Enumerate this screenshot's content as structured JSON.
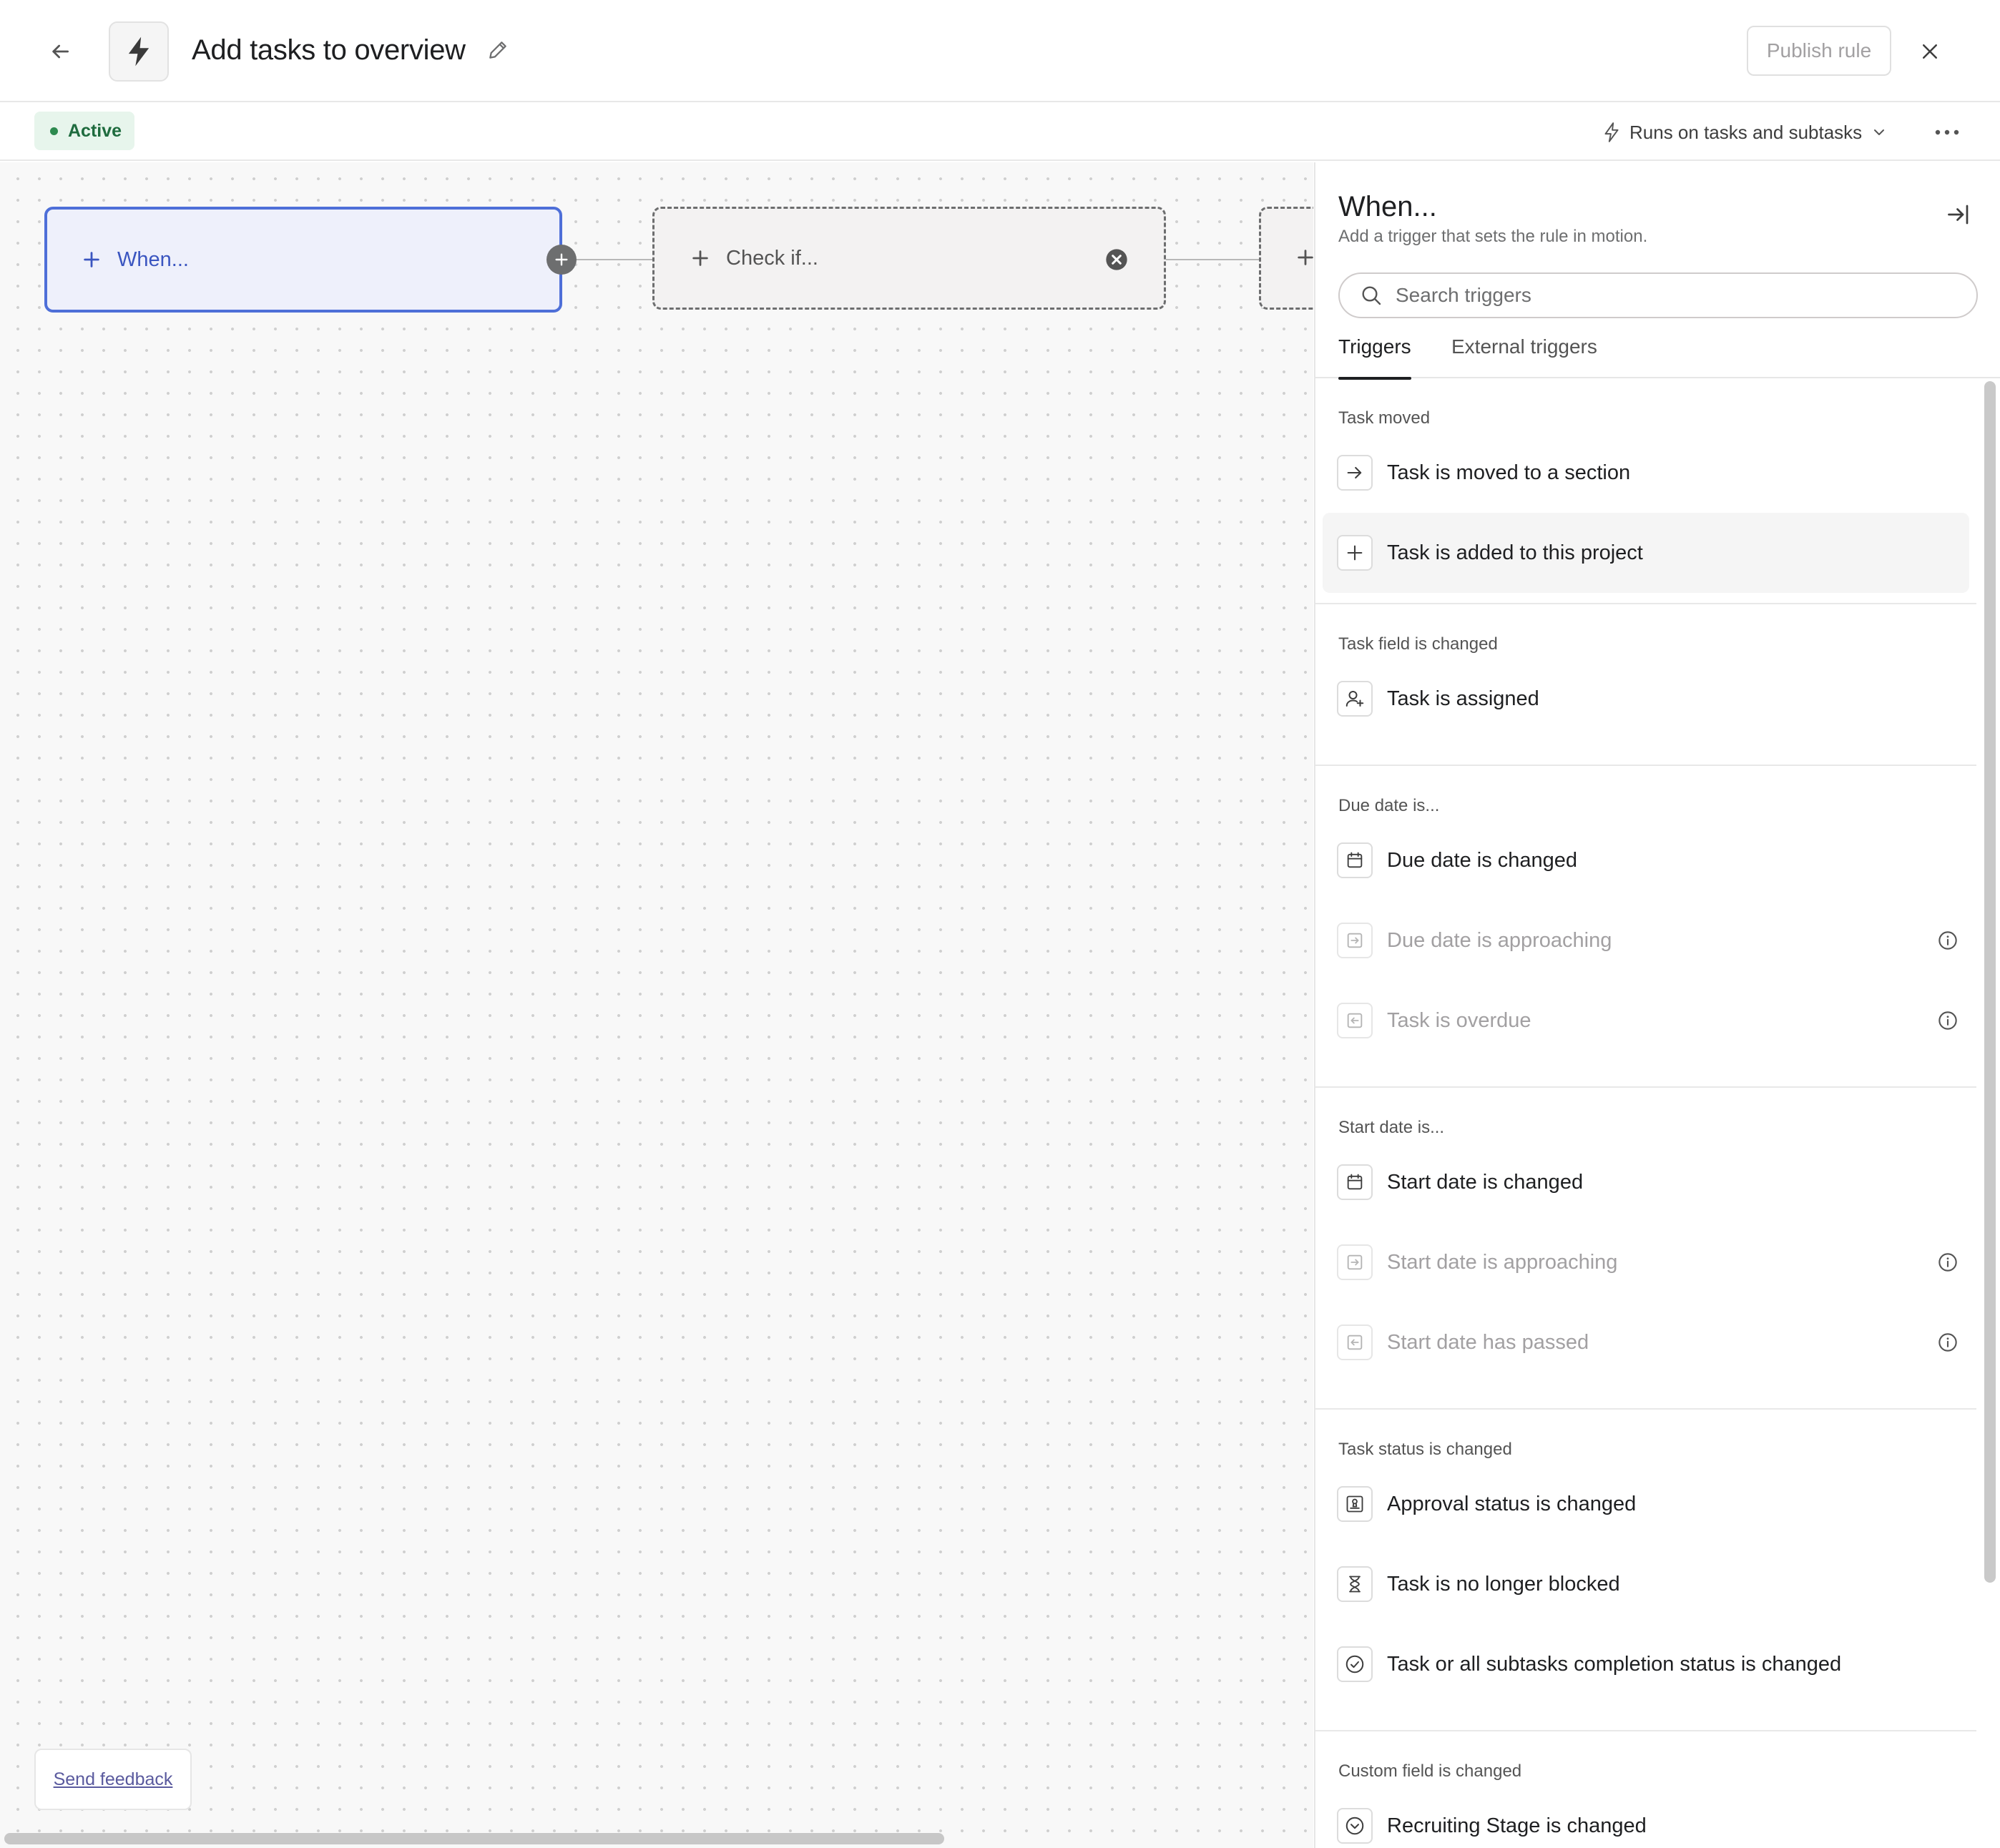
{
  "header": {
    "title": "Add tasks to overview",
    "publish_label": "Publish rule",
    "icons": {
      "back": "arrow-left-icon",
      "rule": "lightning-icon",
      "edit": "pencil-icon",
      "close": "close-icon"
    }
  },
  "subheader": {
    "status_label": "Active",
    "status_color": "#2d8a4f",
    "runs_on_label": "Runs on tasks and subtasks",
    "icons": {
      "runs_on": "lightning-outline-icon",
      "dropdown": "chevron-down-icon",
      "more": "more-horizontal-icon"
    }
  },
  "canvas": {
    "when_node_label": "When...",
    "check_node_label": "Check if...",
    "send_feedback_label": "Send feedback",
    "accent_color": "#4e6fd8"
  },
  "panel": {
    "title": "When...",
    "subtitle": "Add a trigger that sets the rule in motion.",
    "search_placeholder": "Search triggers",
    "tabs": [
      {
        "label": "Triggers",
        "active": true
      },
      {
        "label": "External triggers",
        "active": false
      }
    ],
    "groups": [
      {
        "title": "Task moved",
        "items": [
          {
            "label": "Task is moved to a section",
            "icon": "arrow-right-icon",
            "disabled": false,
            "info": false
          },
          {
            "label": "Task is added to this project",
            "icon": "plus-icon",
            "disabled": false,
            "info": false,
            "hover": true
          }
        ]
      },
      {
        "title": "Task field is changed",
        "items": [
          {
            "label": "Task is assigned",
            "icon": "user-plus-icon",
            "disabled": false,
            "info": false
          }
        ]
      },
      {
        "title": "Due date is...",
        "items": [
          {
            "label": "Due date is changed",
            "icon": "calendar-icon",
            "disabled": false,
            "info": false
          },
          {
            "label": "Due date is approaching",
            "icon": "calendar-arrow-in-icon",
            "disabled": true,
            "info": true
          },
          {
            "label": "Task is overdue",
            "icon": "calendar-arrow-out-icon",
            "disabled": true,
            "info": true
          }
        ]
      },
      {
        "title": "Start date is...",
        "items": [
          {
            "label": "Start date is changed",
            "icon": "calendar-icon",
            "disabled": false,
            "info": false
          },
          {
            "label": "Start date is approaching",
            "icon": "calendar-arrow-in-icon",
            "disabled": true,
            "info": true
          },
          {
            "label": "Start date has passed",
            "icon": "calendar-arrow-out-icon",
            "disabled": true,
            "info": true
          }
        ]
      },
      {
        "title": "Task status is changed",
        "items": [
          {
            "label": "Approval status is changed",
            "icon": "approval-stamp-icon",
            "disabled": false,
            "info": false
          },
          {
            "label": "Task is no longer blocked",
            "icon": "hourglass-icon",
            "disabled": false,
            "info": false
          },
          {
            "label": "Task or all subtasks completion status is changed",
            "icon": "check-circle-icon",
            "disabled": false,
            "info": false
          }
        ]
      },
      {
        "title": "Custom field is changed",
        "items": [
          {
            "label": "Recruiting Stage is changed",
            "icon": "chevron-circle-icon",
            "disabled": false,
            "info": false
          }
        ]
      }
    ]
  }
}
